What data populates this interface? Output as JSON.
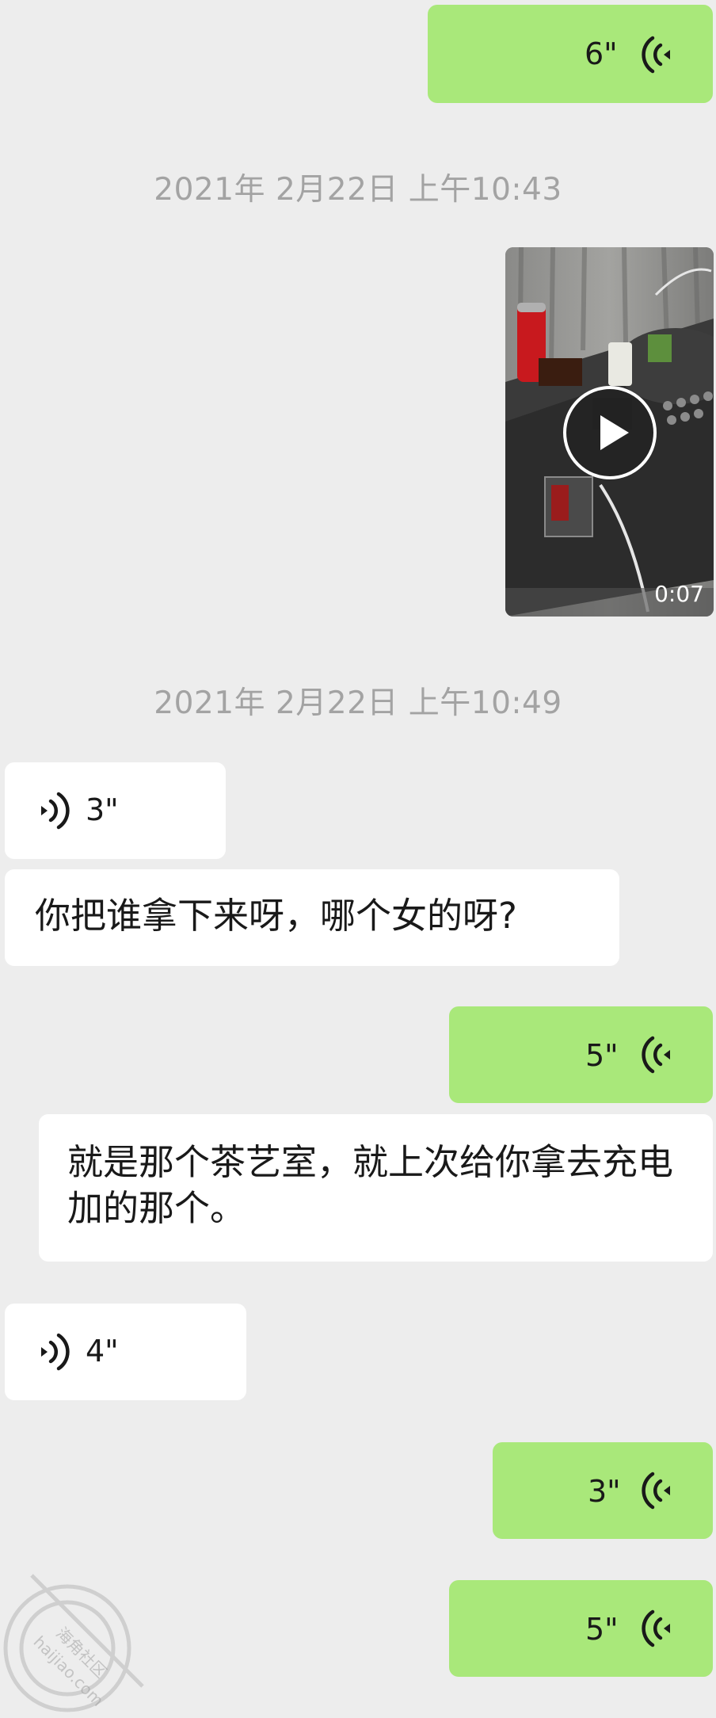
{
  "messages": [
    {
      "kind": "voice-out",
      "duration": "6\""
    },
    {
      "kind": "timestamp",
      "text": "2021年 2月22日 上午10:43"
    },
    {
      "kind": "video-out",
      "duration": "0:07"
    },
    {
      "kind": "timestamp",
      "text": "2021年 2月22日 上午10:49"
    },
    {
      "kind": "voice-in",
      "duration": "3\""
    },
    {
      "kind": "text-in",
      "text": "你把谁拿下来呀，哪个女的呀?"
    },
    {
      "kind": "voice-out",
      "duration": "5\""
    },
    {
      "kind": "text-in",
      "text": "就是那个茶艺室，就上次给你拿去充电加的那个。"
    },
    {
      "kind": "voice-in",
      "duration": "4\""
    },
    {
      "kind": "voice-out",
      "duration": "3\""
    },
    {
      "kind": "voice-out",
      "duration": "5\""
    }
  ],
  "watermark": {
    "line1": "海角社区",
    "line2": "haijiao.com"
  },
  "colors": {
    "background": "#ededed",
    "outgoing": "#a9e87a",
    "incoming": "#ffffff",
    "timestamp": "#a3a3a3"
  }
}
